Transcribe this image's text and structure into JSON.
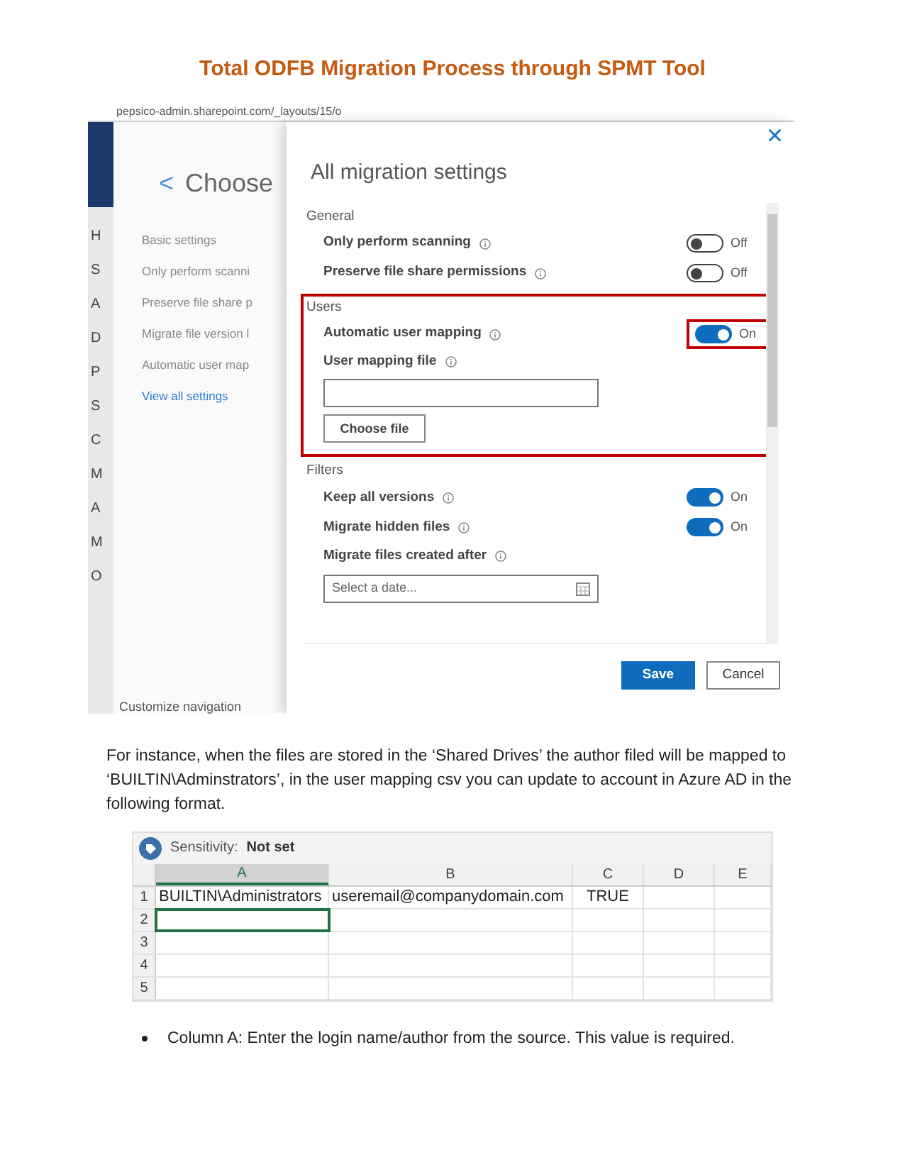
{
  "title": "Total ODFB Migration Process through SPMT Tool",
  "screenshot": {
    "url": "pepsico-admin.sharepoint.com/_layouts/15/o",
    "nav_letters": [
      "H",
      "S",
      "A",
      "D",
      "P",
      "S",
      "C",
      "M",
      "A",
      "M",
      "O"
    ],
    "customize": "Customize navigation",
    "choose_panel": {
      "back": "<",
      "title": "Choose",
      "items": [
        {
          "label": "Basic settings",
          "kind": "heading"
        },
        {
          "label": "Only perform scanni",
          "kind": "item"
        },
        {
          "label": "Preserve file share p",
          "kind": "item"
        },
        {
          "label": "Migrate file version l",
          "kind": "item"
        },
        {
          "label": "Automatic user map",
          "kind": "item"
        },
        {
          "label": "View all settings",
          "kind": "link"
        }
      ]
    },
    "settings": {
      "close": "×",
      "title": "All migration settings",
      "sections": [
        {
          "label": "General",
          "items": [
            {
              "kind": "toggle",
              "label": "Only perform scanning",
              "on": false,
              "state": "Off"
            },
            {
              "kind": "toggle",
              "label": "Preserve file share permissions",
              "on": false,
              "state": "Off"
            }
          ]
        },
        {
          "label": "Users",
          "highlighted": true,
          "items": [
            {
              "kind": "toggle",
              "label": "Automatic user mapping",
              "on": true,
              "state": "On",
              "highlighted": true
            },
            {
              "kind": "file",
              "label": "User mapping file",
              "button": "Choose file"
            }
          ]
        },
        {
          "label": "Filters",
          "items": [
            {
              "kind": "toggle",
              "label": "Keep all versions",
              "on": true,
              "state": "On"
            },
            {
              "kind": "toggle",
              "label": "Migrate hidden files",
              "on": true,
              "state": "On"
            },
            {
              "kind": "date",
              "label": "Migrate files created after",
              "placeholder": "Select a date..."
            }
          ]
        }
      ],
      "buttons": [
        {
          "label": "Save",
          "kind": "primary"
        },
        {
          "label": "Cancel",
          "kind": "secondary"
        }
      ]
    }
  },
  "paragraph": "For instance, when the files are stored in the ‘Shared Drives’ the author filed will be mapped to ‘BUILTIN\\Adminstrators’, in the user mapping csv you can update to account in Azure AD in the following format.",
  "spreadsheet": {
    "sensitivity_label": "Sensitivity:",
    "sensitivity_value": "Not set",
    "columns": [
      {
        "label": "A",
        "selected": true
      },
      {
        "label": "B",
        "selected": false
      },
      {
        "label": "C",
        "selected": false
      },
      {
        "label": "D",
        "selected": false
      },
      {
        "label": "E",
        "selected": false
      }
    ],
    "rows": [
      {
        "number": "1",
        "cells": [
          {
            "text": "BUILTIN\\Administrators",
            "selected": false
          },
          {
            "text": "useremail@companydomain.com",
            "selected": false
          },
          {
            "text": "TRUE",
            "selected": false
          },
          {
            "selected": false
          },
          {
            "selected": false
          }
        ]
      },
      {
        "number": "2",
        "cells": [
          {
            "selected": true
          },
          {
            "selected": false
          },
          {
            "selected": false
          },
          {
            "selected": false
          },
          {
            "selected": false
          }
        ]
      },
      {
        "number": "3",
        "cells": [
          {
            "selected": false
          },
          {
            "selected": false
          },
          {
            "selected": false
          },
          {
            "selected": false
          },
          {
            "selected": false
          }
        ]
      },
      {
        "number": "4",
        "cells": [
          {
            "selected": false
          },
          {
            "selected": false
          },
          {
            "selected": false
          },
          {
            "selected": false
          },
          {
            "selected": false
          }
        ]
      },
      {
        "number": "5",
        "cells": [
          {
            "selected": false
          },
          {
            "selected": false
          },
          {
            "selected": false
          },
          {
            "selected": false
          },
          {
            "selected": false
          }
        ]
      }
    ]
  },
  "bullets": [
    "Column A: Enter the login name/author from the source. This value is required."
  ]
}
